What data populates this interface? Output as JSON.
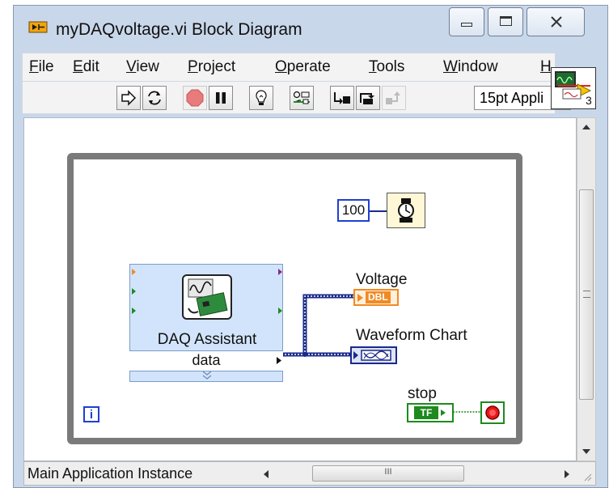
{
  "window": {
    "title": "myDAQvoltage.vi Block Diagram",
    "controls": [
      "minimize",
      "maximize",
      "close"
    ]
  },
  "menubar": {
    "items": [
      {
        "label": "File",
        "accel": "F"
      },
      {
        "label": "Edit",
        "accel": "E"
      },
      {
        "label": "View",
        "accel": "V"
      },
      {
        "label": "Project",
        "accel": "P"
      },
      {
        "label": "Operate",
        "accel": "O"
      },
      {
        "label": "Tools",
        "accel": "T"
      },
      {
        "label": "Window",
        "accel": "W"
      },
      {
        "label": "H",
        "accel": "H"
      }
    ]
  },
  "toolbar": {
    "buttons": [
      "run-icon",
      "run-continuously-icon",
      "abort-icon",
      "pause-icon",
      "highlight-execution-icon",
      "retain-wire-values-icon",
      "step-into-icon",
      "step-over-icon",
      "step-out-icon"
    ],
    "font_select": "15pt Appli"
  },
  "vi_icon": {
    "label": "3"
  },
  "diagram": {
    "wait_constant": "100",
    "daq_assistant": {
      "title": "DAQ Assistant",
      "output": "data"
    },
    "voltage": {
      "label": "Voltage",
      "type": "DBL"
    },
    "waveform_chart": {
      "label": "Waveform Chart"
    },
    "stop": {
      "label": "stop",
      "type": "TF"
    },
    "iteration": "i"
  },
  "statusbar": {
    "context": "Main Application Instance",
    "scroll_grip": "III"
  },
  "colors": {
    "loop_border": "#7a7a7a",
    "wire_blue": "#1a2a8a",
    "wire_green": "#1e8a1e",
    "dbl_orange": "#f08a24",
    "express_blue": "#d2e4fb"
  }
}
